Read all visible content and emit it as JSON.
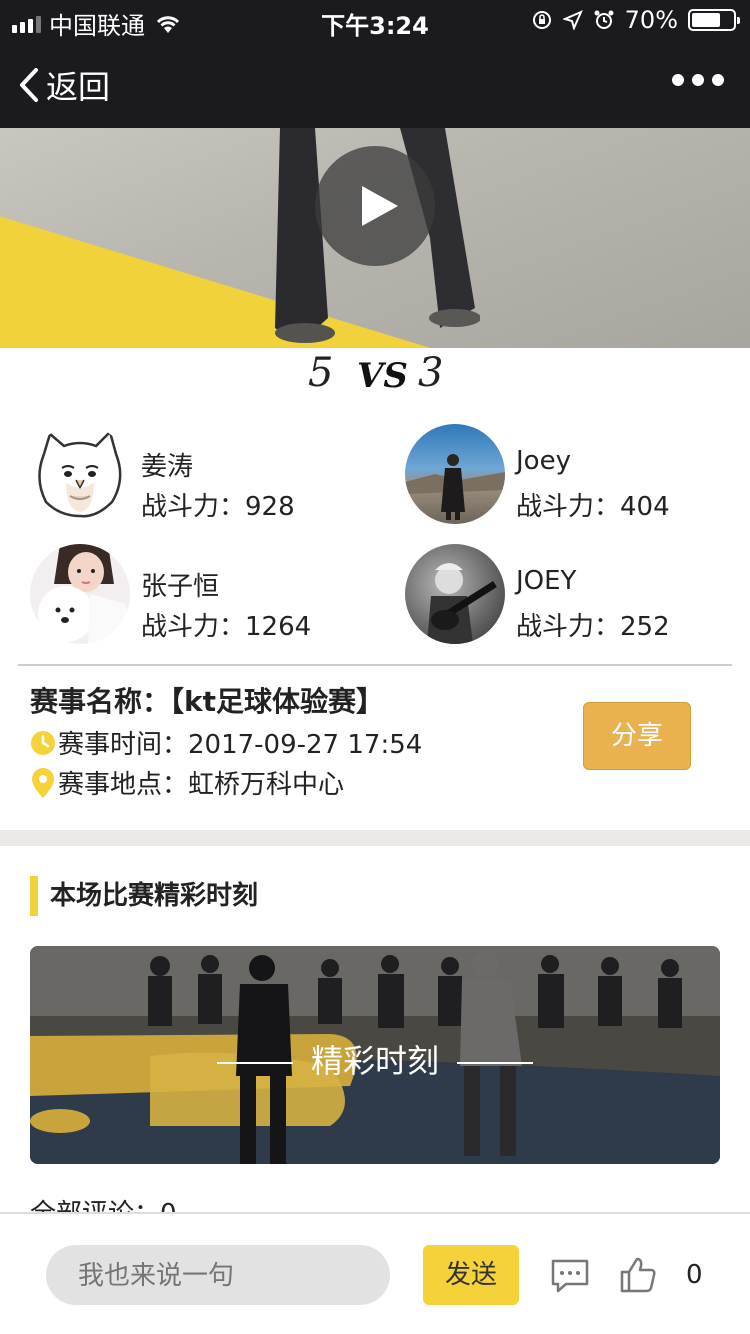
{
  "status_bar": {
    "carrier": "中国联通",
    "time": "下午3:24",
    "battery": "70%",
    "battery_level": 0.7
  },
  "nav": {
    "back_label": "返回"
  },
  "score": {
    "left": "5",
    "vs": "VS",
    "right": "3"
  },
  "players": [
    {
      "name": "姜涛",
      "power": "战斗力：928"
    },
    {
      "name": "Joey",
      "power": "战斗力：404"
    },
    {
      "name": "张子恒",
      "power": "战斗力：1264"
    },
    {
      "name": "JOEY",
      "power": "战斗力：252"
    }
  ],
  "match": {
    "title": "赛事名称：【kt足球体验赛】",
    "time": "赛事时间：2017-09-27 17:54",
    "location": "赛事地点：虹桥万科中心",
    "share_label": "分享"
  },
  "highlights": {
    "section_title": "本场比赛精彩时刻",
    "banner_label": "精彩时刻"
  },
  "comments": {
    "count_label": "全部评论：0"
  },
  "bottom": {
    "input_placeholder": "我也来说一句",
    "send_label": "发送",
    "like_count": "0"
  },
  "colors": {
    "accent_yellow": "#f5d23a",
    "share_orange": "#e9b24f",
    "nav_dark": "#1a1a1f"
  }
}
